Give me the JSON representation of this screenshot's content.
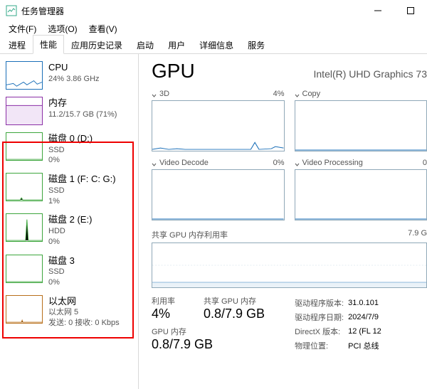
{
  "window": {
    "title": "任务管理器"
  },
  "menus": {
    "file": "文件(F)",
    "options": "选项(O)",
    "view": "查看(V)"
  },
  "tabs": {
    "processes": "进程",
    "performance": "性能",
    "app_history": "应用历史记录",
    "startup": "启动",
    "users": "用户",
    "details": "详细信息",
    "services": "服务"
  },
  "sidebar": {
    "cpu": {
      "title": "CPU",
      "sub": "24% 3.86 GHz"
    },
    "mem": {
      "title": "内存",
      "sub": "11.2/15.7 GB (71%)"
    },
    "disk0": {
      "title": "磁盘 0 (D:)",
      "sub1": "SSD",
      "sub2": "0%"
    },
    "disk1": {
      "title": "磁盘 1 (F: C: G:)",
      "sub1": "SSD",
      "sub2": "1%"
    },
    "disk2": {
      "title": "磁盘 2 (E:)",
      "sub1": "HDD",
      "sub2": "0%"
    },
    "disk3": {
      "title": "磁盘 3",
      "sub1": "SSD",
      "sub2": "0%"
    },
    "eth": {
      "title": "以太网",
      "sub1": "以太网 5",
      "sub2": "发送: 0 接收: 0 Kbps"
    }
  },
  "gpu": {
    "heading": "GPU",
    "model": "Intel(R) UHD Graphics 73",
    "panels": {
      "p3d": {
        "label": "3D",
        "pct": "4%"
      },
      "copy": {
        "label": "Copy",
        "pct": ""
      },
      "decode": {
        "label": "Video Decode",
        "pct": "0%"
      },
      "process": {
        "label": "Video Processing",
        "pct": "0"
      }
    },
    "shared": {
      "label": "共享 GPU 内存利用率",
      "right": "7.9 G"
    },
    "stats": {
      "util_label": "利用率",
      "util_value": "4%",
      "shared_label": "共享 GPU 内存",
      "shared_value": "0.8/7.9 GB",
      "gpumem_label": "GPU 内存",
      "gpumem_value": "0.8/7.9 GB"
    },
    "props": {
      "driver_ver_label": "驱动程序版本:",
      "driver_ver_value": "31.0.101",
      "driver_date_label": "驱动程序日期:",
      "driver_date_value": "2024/7/9",
      "directx_label": "DirectX 版本:",
      "directx_value": "12 (FL 12",
      "location_label": "物理位置:",
      "location_value": "PCI 总线"
    }
  },
  "chart_data": [
    {
      "type": "line",
      "title": "3D",
      "ylim": [
        0,
        100
      ],
      "values": [
        2,
        3,
        2,
        4,
        3,
        2,
        3,
        2,
        5,
        3,
        2,
        3,
        4,
        2,
        3,
        2,
        6,
        3,
        2,
        4
      ]
    },
    {
      "type": "line",
      "title": "Copy",
      "ylim": [
        0,
        100
      ],
      "values": [
        0,
        0,
        0,
        0,
        0,
        0,
        0,
        0,
        0,
        0,
        0,
        0,
        0,
        0,
        0,
        0,
        0,
        0,
        0,
        0
      ]
    },
    {
      "type": "line",
      "title": "Video Decode",
      "ylim": [
        0,
        100
      ],
      "values": [
        0,
        0,
        0,
        0,
        0,
        0,
        0,
        0,
        0,
        0,
        0,
        0,
        0,
        0,
        0,
        0,
        0,
        0,
        0,
        0
      ]
    },
    {
      "type": "line",
      "title": "Video Processing",
      "ylim": [
        0,
        100
      ],
      "values": [
        0,
        0,
        0,
        0,
        0,
        0,
        0,
        0,
        0,
        0,
        0,
        0,
        0,
        0,
        0,
        0,
        0,
        0,
        0,
        0
      ]
    },
    {
      "type": "line",
      "title": "共享 GPU 内存利用率",
      "ylim": [
        0,
        7.9
      ],
      "values": [
        0.8,
        0.8,
        0.8,
        0.8,
        0.8,
        0.8,
        0.8,
        0.8,
        0.8,
        0.8,
        0.8,
        0.8,
        0.8,
        0.8,
        0.8,
        0.8,
        0.8,
        0.8,
        0.8,
        0.8
      ]
    }
  ]
}
